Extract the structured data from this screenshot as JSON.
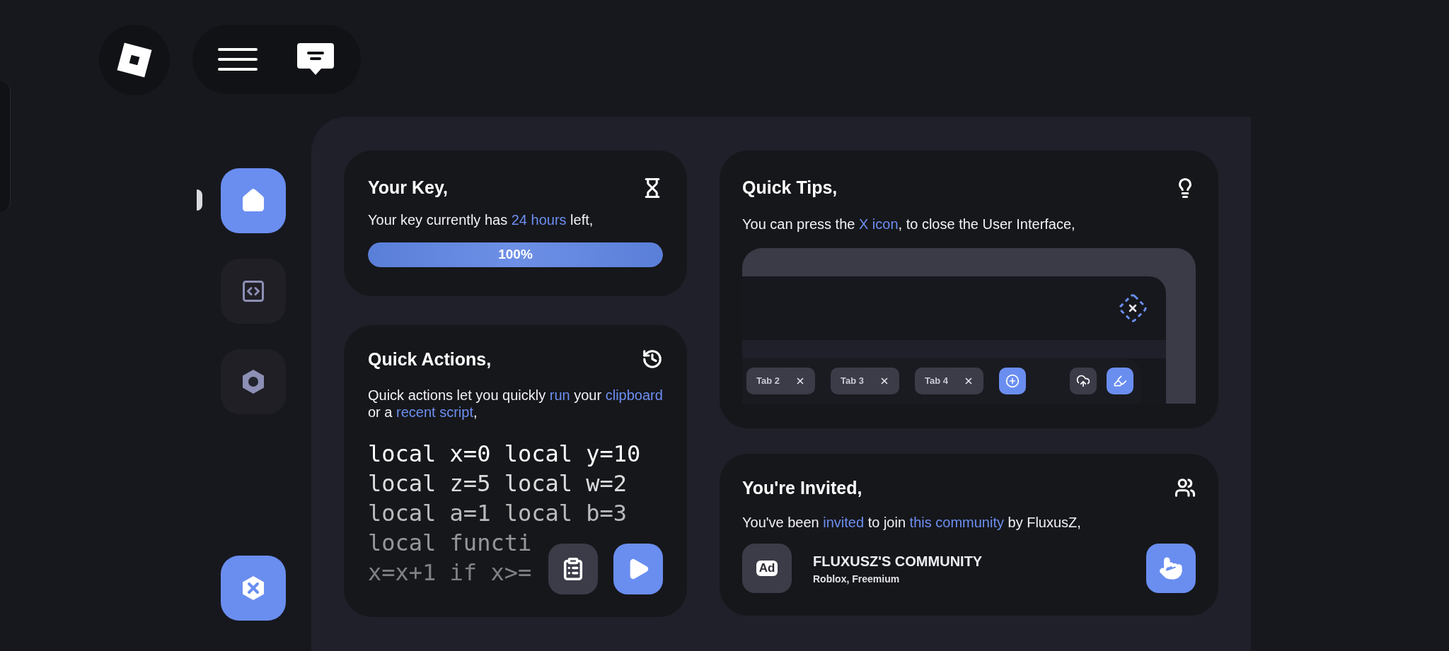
{
  "sidebar": {
    "items": [
      {
        "kind": "home",
        "selected": true
      },
      {
        "kind": "code",
        "selected": false
      },
      {
        "kind": "settings",
        "selected": false
      }
    ]
  },
  "key_card": {
    "title": "Your Key,",
    "text": [
      {
        "text": "Your key currently has ",
        "highlight": false
      },
      {
        "text": "24 hours",
        "highlight": true
      },
      {
        "text": " left,",
        "highlight": false
      }
    ],
    "progress": {
      "level": 1,
      "label": "100%"
    }
  },
  "quick_actions": {
    "title": "Quick Actions,",
    "text": [
      {
        "text": "Quick actions let you quickly ",
        "highlight": false
      },
      {
        "text": "run",
        "highlight": true
      },
      {
        "text": " your ",
        "highlight": false
      },
      {
        "text": "clipboard",
        "highlight": true
      },
      {
        "text": " or a ",
        "highlight": false
      },
      {
        "text": "recent script",
        "highlight": true
      },
      {
        "text": ",",
        "highlight": false
      }
    ],
    "code_lines": [
      "local x=0 local y=10",
      "local z=5 local w=2",
      "local a=1 local b=3",
      "local functi",
      "x=x+1 if x>="
    ]
  },
  "quick_tips": {
    "title": "Quick Tips,",
    "text": [
      {
        "text": "You can press the ",
        "highlight": false
      },
      {
        "text": "X icon",
        "highlight": true
      },
      {
        "text": ", to close the User Interface,",
        "highlight": false
      }
    ],
    "preview": {
      "tabs": [
        {
          "label": "Tab 2"
        },
        {
          "label": "Tab 3"
        },
        {
          "label": "Tab 4"
        }
      ]
    }
  },
  "invite": {
    "title": "You're Invited,",
    "text": [
      {
        "text": "You've been ",
        "highlight": false
      },
      {
        "text": "invited",
        "highlight": true
      },
      {
        "text": " to join ",
        "highlight": false
      },
      {
        "text": "this community",
        "highlight": true
      },
      {
        "text": " by FluxusZ,",
        "highlight": false
      }
    ],
    "community": {
      "badge": "Ad",
      "name": "FLUXUSZ'S COMMUNITY",
      "details": "Roblox, Freemium"
    }
  }
}
